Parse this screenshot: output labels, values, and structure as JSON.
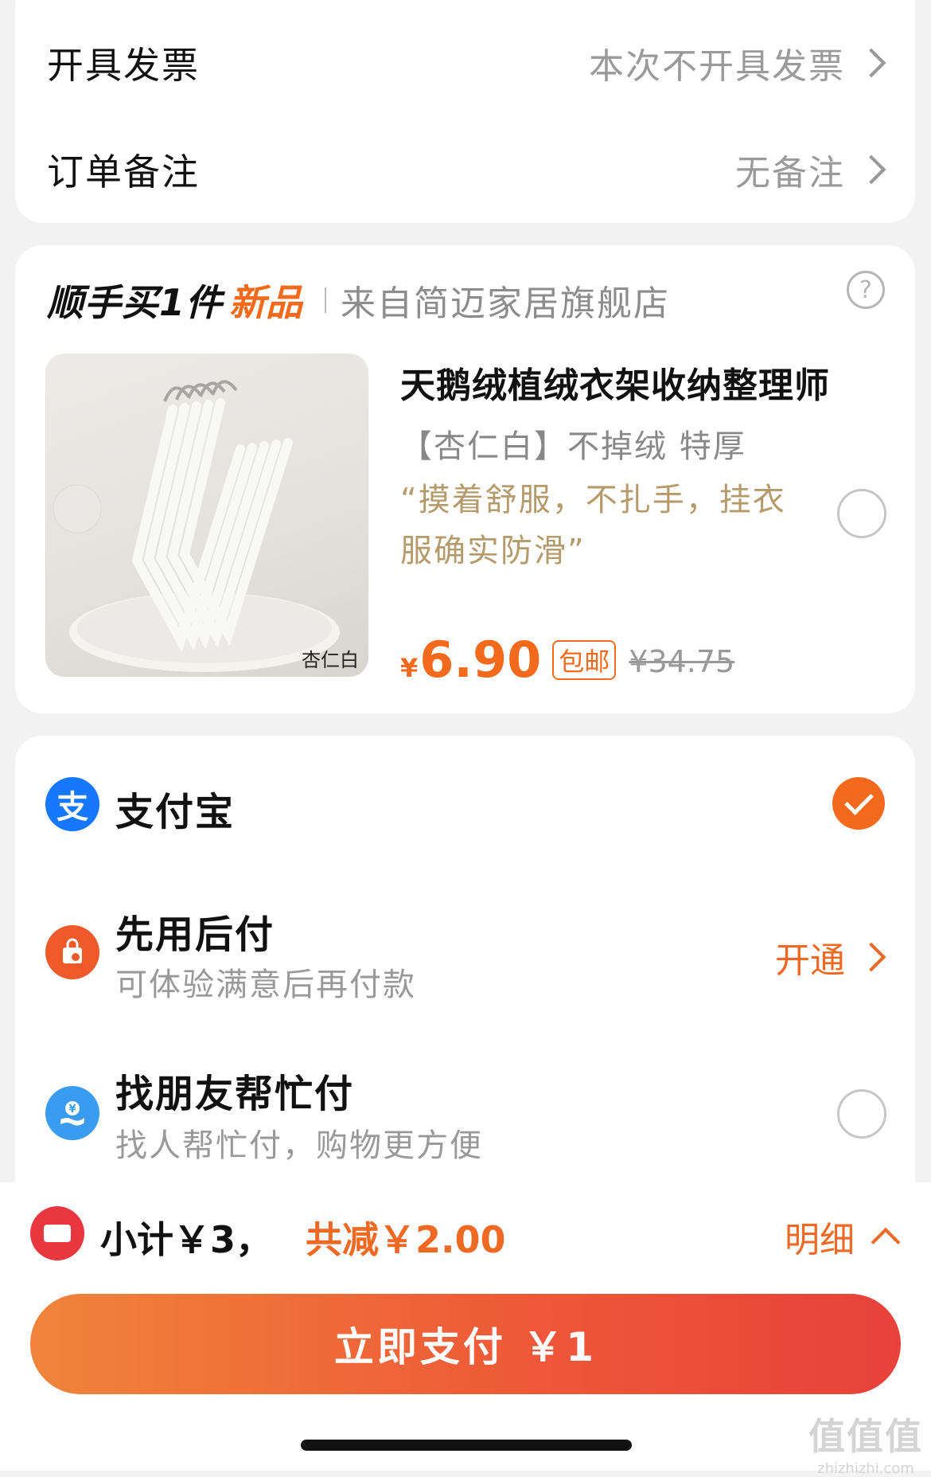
{
  "invoice": {
    "label": "开具发票",
    "value": "本次不开具发票"
  },
  "remark": {
    "label": "订单备注",
    "value": "无备注"
  },
  "addon": {
    "title": "顺手买1件",
    "badge": "新品",
    "store": "来自简迈家居旗舰店",
    "help": "?",
    "product": {
      "name": "天鹅绒植绒衣架收纳整理师",
      "spec": "【杏仁白】不掉绒 特厚",
      "quote": "“摸着舒服，不扎手，挂衣服确实防滑”",
      "image_caption": "杏仁白",
      "currency": "¥",
      "price": "6.90",
      "shipping": "包邮",
      "original_price": "¥34.75",
      "selected": false
    }
  },
  "payment": {
    "methods": [
      {
        "name": "支付宝",
        "subtitle": "",
        "icon": "alipay-icon",
        "selected": true
      },
      {
        "name": "先用后付",
        "subtitle": "可体验满意后再付款",
        "icon": "pay-later-icon",
        "action": "开通"
      },
      {
        "name": "找朋友帮忙付",
        "subtitle": "找人帮忙付，购物更方便",
        "icon": "friend-pay-icon",
        "selected": false
      }
    ]
  },
  "summary": {
    "subtotal": "小计￥3，",
    "discount": "共减￥2.00",
    "detail": "明细"
  },
  "pay_button": {
    "label": "立即支付 ￥1"
  },
  "watermark": {
    "big": "值值值",
    "small": "zhizhizhi.com"
  },
  "colors": {
    "accent": "#f36a1c",
    "alipay": "#1677ff",
    "price": "#f36a1c",
    "quote": "#b59a6c"
  }
}
